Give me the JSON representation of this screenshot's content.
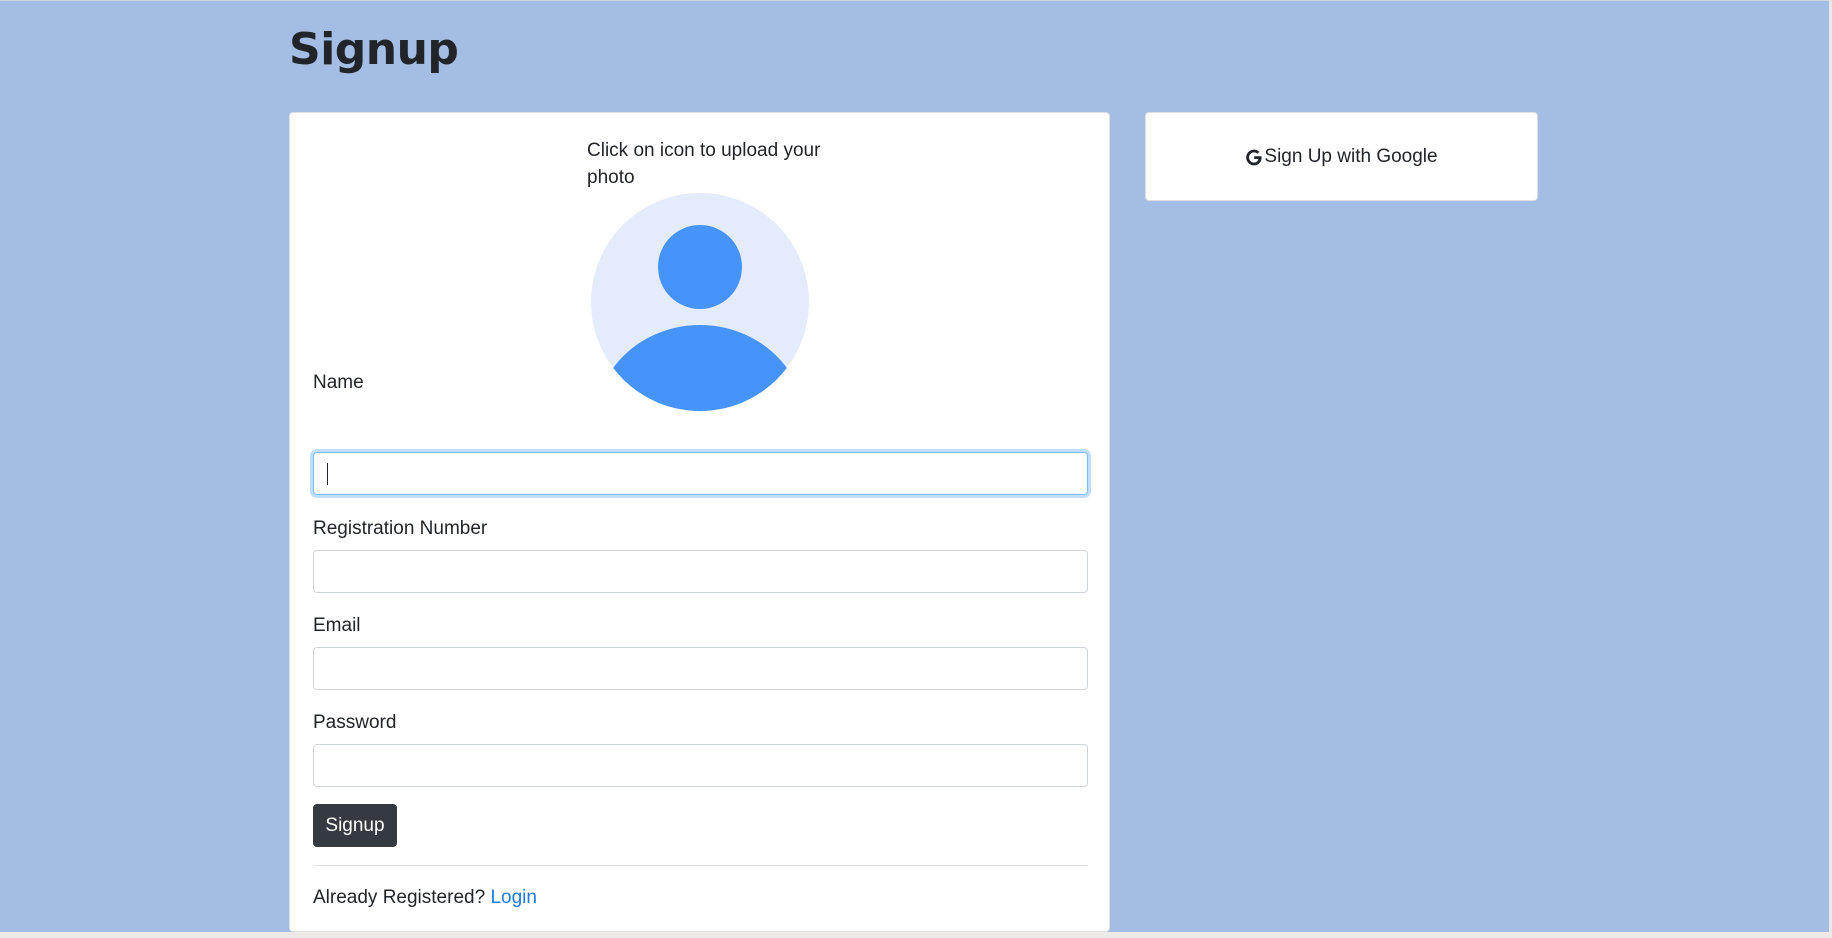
{
  "page": {
    "title": "Signup"
  },
  "signup_form": {
    "upload_hint": "Click on icon to upload your photo",
    "fields": [
      {
        "label": "Name",
        "value": "",
        "placeholder": ""
      },
      {
        "label": "Registration Number",
        "value": "",
        "placeholder": ""
      },
      {
        "label": "Email",
        "value": "",
        "placeholder": ""
      },
      {
        "label": "Password",
        "value": "",
        "placeholder": ""
      }
    ],
    "submit_label": "Signup",
    "already_registered_text": "Already Registered?",
    "login_link_label": "Login"
  },
  "google_signup": {
    "label": "Sign Up with Google",
    "icon": "google-g-icon"
  },
  "colors": {
    "page_background": "#a3bde4",
    "avatar_background": "#e4ebfb",
    "avatar_figure": "#4694fa",
    "submit_button": "#343a40",
    "link": "#1e7be0"
  }
}
